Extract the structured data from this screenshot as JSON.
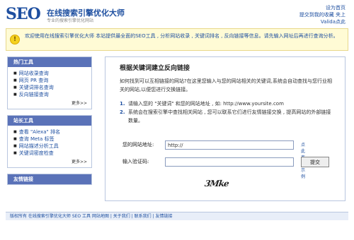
{
  "header": {
    "logo_seo": "SEO",
    "logo_name": "在线搜索引擎优化大师",
    "logo_slogan": "专业的搜索引擎优化网站",
    "top_links": [
      "设为首页",
      "提交到我的收藏 夹上",
      "Valida点此"
    ]
  },
  "notice": {
    "icon": "info-icon",
    "text": "欢迎使用在线搜索引擎优化大师 本站提供最全面的SEO工具 , 分析网站收录 , 关键词排名 , 反向链接等信息。请先输入网址后再进行查询分析。"
  },
  "sidebar": {
    "boxes": [
      {
        "title": "热门工具",
        "items": [
          "网站收录查询",
          "网页 PR 查询",
          "关键词排名查询",
          "反向链接查询"
        ],
        "more": "更多>>"
      },
      {
        "title": "站长工具",
        "items": [
          "查看 \"Alexa\" 排名",
          "查询 Meta 标签",
          "网站描述分析工具",
          "关键词密度检查"
        ],
        "more": "更多>>"
      },
      {
        "title": "友情链接",
        "items": [],
        "more": ""
      }
    ]
  },
  "main": {
    "title": "根据关键词建立反向链接",
    "desc": "如何找到可以互相链接的网站?在这里您输入与您的网站相关的关键词,系统会自动查找与您行业相关的网站,以便您进行交换链接。",
    "steps": [
      {
        "num": "1.",
        "text": "请输入您的 \"关键词\" 和您的网站地址 , 如: http://www.yoursite.com"
      },
      {
        "num": "2.",
        "text": "系统会在搜索引擎中查找相关网站 , 您可以联系它们进行友情链接交换 , 提高网站的外部链接数量。"
      }
    ],
    "form": {
      "url_label": "您的网站地址:",
      "url_value": "http://",
      "url_link": "点此查看示例",
      "captcha_label": "输入验证码:",
      "captcha_value": "",
      "submit_label": "提交",
      "captcha_text": "3Mke"
    }
  },
  "footer": {
    "text": "版权所有 在线搜索引擎优化大师 SEO 工具 网站地图 | 关于我们 | 联系我们 | 友情链接"
  }
}
